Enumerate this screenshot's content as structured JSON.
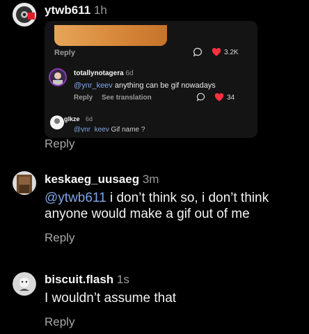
{
  "comments": [
    {
      "username": "ytwb611",
      "time": "1h",
      "embed": {
        "reply": "Reply",
        "likes": "3.2K",
        "nested": [
          {
            "username": "totallynotagera",
            "time": "6d",
            "mention": "@ynr_keev",
            "text": "anything can be gif nowadays",
            "reply": "Reply",
            "see_translation": "See translation",
            "likes": "34"
          },
          {
            "username": "glkze",
            "time": "6d",
            "mention": "@ynr_keev",
            "text": "Gif name ?"
          }
        ]
      },
      "reply": "Reply"
    },
    {
      "username": "keskaeg_uusaeg",
      "time": "3m",
      "mention": "@ytwb611",
      "text": "i don’t think so, i don’t think anyone would make a gif out of me",
      "reply": "Reply"
    },
    {
      "username": "biscuit.flash",
      "time": "1s",
      "text": "I wouldn’t assume that",
      "reply": "Reply"
    }
  ],
  "colors": {
    "background": "#000000",
    "mention": "#7fa6e8",
    "heart": "#ff3040",
    "muted": "#9a9a9a"
  }
}
